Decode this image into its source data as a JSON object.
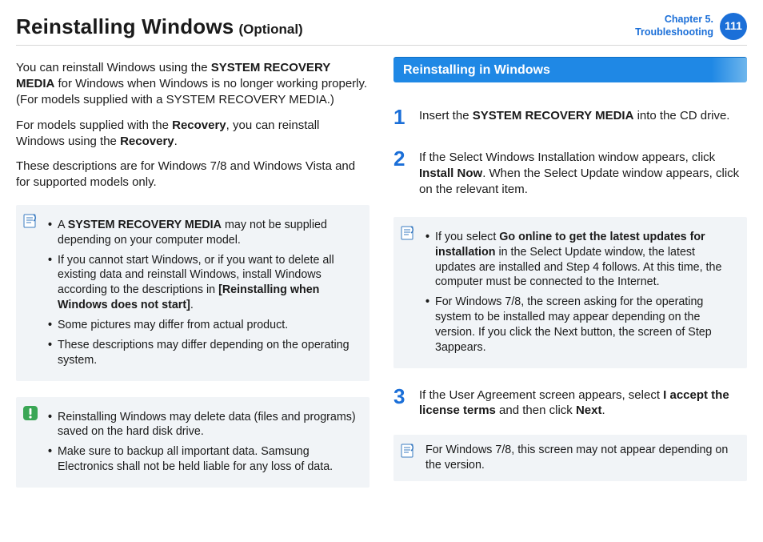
{
  "header": {
    "title_main": "Reinstalling Windows",
    "title_optional": "(Optional)",
    "chapter_line1": "Chapter 5.",
    "chapter_line2": "Troubleshooting",
    "page_number": "111"
  },
  "left": {
    "p1_pre": "You can reinstall Windows using the ",
    "p1_bold": "SYSTEM RECOVERY MEDIA",
    "p1_post": " for Windows when Windows is no longer working properly. (For models supplied with a SYSTEM RECOVERY MEDIA.)",
    "p2_pre": "For models supplied with the ",
    "p2_bold1": "Recovery",
    "p2_mid": ", you can reinstall Windows using the ",
    "p2_bold2": "Recovery",
    "p2_end": ".",
    "p3": "These descriptions are for Windows 7/8 and Windows Vista and for supported models only.",
    "note1_item1_pre": "A ",
    "note1_item1_bold": "SYSTEM RECOVERY MEDIA",
    "note1_item1_post": " may not be supplied depending on your computer model.",
    "note1_item2_pre": "If you cannot start Windows, or if you want to delete all existing data and reinstall Windows, install Windows according to the descriptions in ",
    "note1_item2_bold": "[Reinstalling when Windows does not start]",
    "note1_item2_post": ".",
    "note1_item3": "Some pictures may differ from actual product.",
    "note1_item4": "These descriptions may differ depending on the operating system.",
    "warn_item1": "Reinstalling Windows may delete data (files and programs) saved on the hard disk drive.",
    "warn_item2": "Make sure to backup all important data. Samsung Electronics shall not be held liable for any loss of data."
  },
  "right": {
    "section_title": "Reinstalling in Windows",
    "step1_num": "1",
    "step1_pre": "Insert the ",
    "step1_bold": "SYSTEM RECOVERY MEDIA",
    "step1_post": " into the CD drive.",
    "step2_num": "2",
    "step2_pre": "If the Select Windows Installation window appears, click ",
    "step2_bold": "Install Now",
    "step2_post": ". When the Select Update window appears, click on the relevant item.",
    "note2_item1_pre": "If you select ",
    "note2_item1_bold": "Go online to get the latest updates for installation",
    "note2_item1_post": " in the Select Update window, the latest updates are installed and Step 4 follows. At this time, the computer must be connected to the Internet.",
    "note2_item2": "For Windows 7/8, the screen asking for the operating system to be installed may appear depending on the version. If you click the Next button, the screen of Step 3appears.",
    "step3_num": "3",
    "step3_pre": "If the User Agreement screen appears, select ",
    "step3_bold1": "I accept the license terms",
    "step3_mid": " and then click ",
    "step3_bold2": "Next",
    "step3_end": ".",
    "note3": "For Windows 7/8, this screen may not appear depending on the version."
  }
}
